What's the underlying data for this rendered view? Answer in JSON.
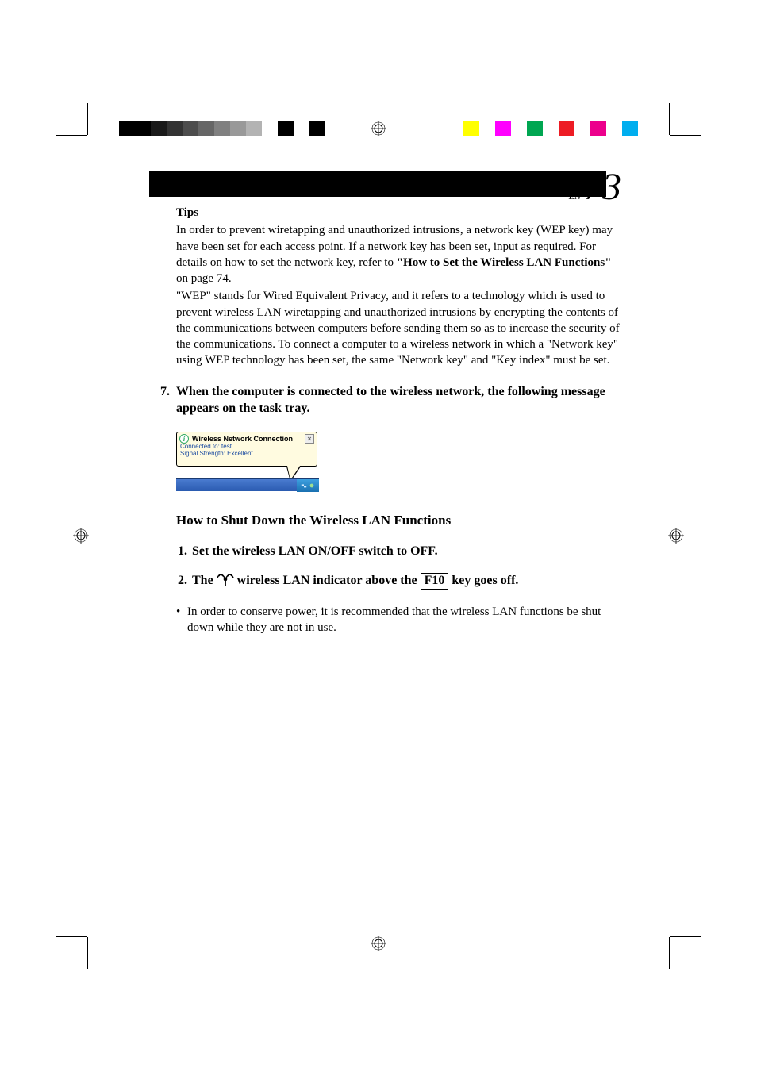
{
  "page": {
    "label_en": "EN",
    "number": "73"
  },
  "tips": {
    "label": "Tips",
    "p1_a": "In order to prevent wiretapping and unauthorized intrusions, a network key (WEP key) may have been set for each access point.  If a network key has been set, input as required.  For details on how to set the network key, refer to ",
    "p1_bold": "\"How to Set the Wireless LAN Functions\"",
    "p1_b": " on page 74.",
    "p2": "\"WEP\" stands for Wired Equivalent Privacy, and it refers to a technology which is used to prevent wireless LAN wiretapping and unauthorized intrusions by encrypting the contents of the communications between computers before sending them so as to increase the security of the communications.  To connect a computer to a wireless network in which a \"Network key\" using WEP technology has been set, the same \"Network key\" and \"Key index\" must be set."
  },
  "step7": {
    "num": "7.",
    "text": "When the computer is connected to the wireless network, the following message appears  on the task tray."
  },
  "tooltip": {
    "title": "Wireless Network Connection",
    "line1": "Connected to: test",
    "line2": "Signal Strength: Excellent"
  },
  "subhead": "How to Shut Down the Wireless LAN Functions",
  "step1": {
    "num": "1.",
    "text": "Set the wireless LAN ON/OFF switch to OFF."
  },
  "step2": {
    "num": "2.",
    "pre": "The ",
    "mid": " wireless LAN indicator above the ",
    "key": "F10",
    "post": " key goes off."
  },
  "bullet": {
    "dot": "•",
    "text": "In order to conserve power, it is recommended that the wireless LAN functions be shut down while they are not in use."
  },
  "colors": {
    "left_bar": [
      "#000000",
      "#000000",
      "#1a1a1a",
      "#333333",
      "#4d4d4d",
      "#666666",
      "#808080",
      "#999999",
      "#b3b3b3",
      "#ffffff",
      "#000000",
      "#ffffff",
      "#000000"
    ],
    "right_bar": [
      "#ffff00",
      "#ffffff",
      "#ff00ff",
      "#ffffff",
      "#00a651",
      "#ffffff",
      "#ed1c24",
      "#ffffff",
      "#ec008c",
      "#ffffff",
      "#00aeef"
    ]
  }
}
